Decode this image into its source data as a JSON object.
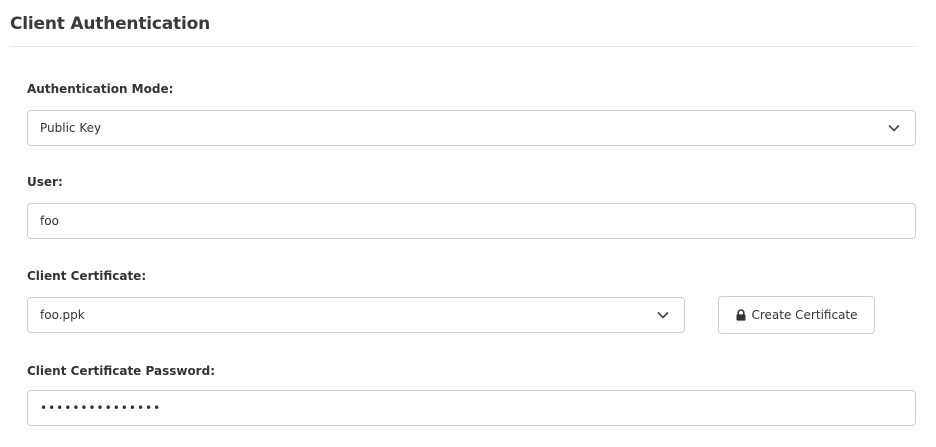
{
  "section": {
    "title": "Client Authentication"
  },
  "auth_mode": {
    "label": "Authentication Mode:",
    "value": "Public Key"
  },
  "user": {
    "label": "User:",
    "value": "foo"
  },
  "client_cert": {
    "label": "Client Certificate:",
    "value": "foo.ppk",
    "create_button_label": "Create Certificate"
  },
  "cert_password": {
    "label": "Client Certificate Password:",
    "value": "•••••••••••••••"
  },
  "icons": {
    "dropdown": "chevron-down-icon",
    "lock": "lock-icon"
  }
}
